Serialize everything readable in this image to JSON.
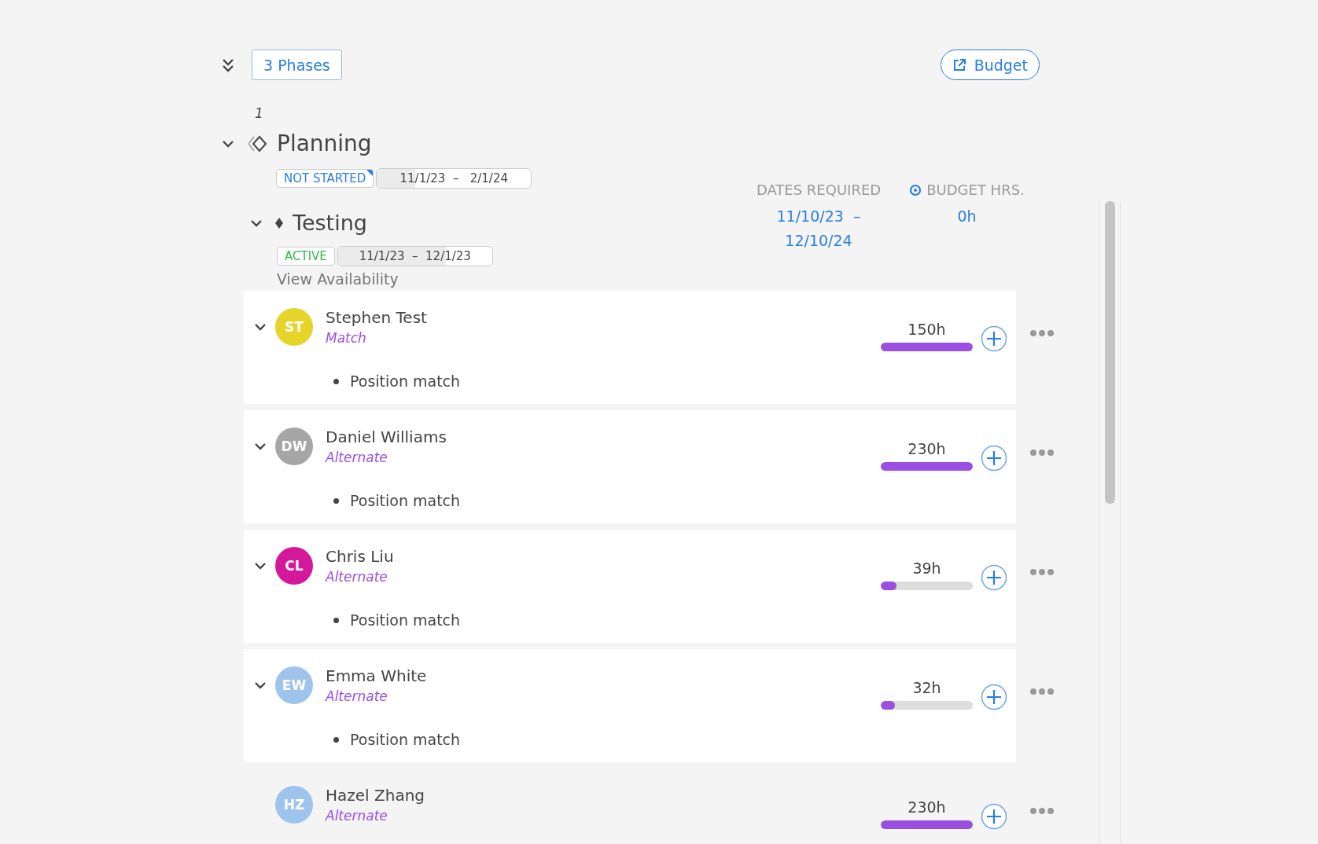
{
  "header": {
    "phases_button": "3 Phases",
    "budget_button": "Budget"
  },
  "phase": {
    "index": "1",
    "title": "Planning",
    "expanded": true,
    "status": {
      "kind": "not_started",
      "label": "NOT STARTED"
    },
    "dates": {
      "start": "11/1/23",
      "separator": "–",
      "end": "2/1/24",
      "level": 0.25
    }
  },
  "requirements": {
    "dates_label": "DATES REQUIRED",
    "dates_start": "11/10/23",
    "dates_separator": "–",
    "dates_end": "12/10/24",
    "budget_label": "BUDGET HRS.",
    "budget_value": "0h"
  },
  "role": {
    "title": "Testing",
    "expanded": true,
    "status": {
      "kind": "active",
      "label": "ACTIVE"
    },
    "dates": {
      "start": "11/1/23",
      "separator": "–",
      "end": "12/1/23",
      "level": 0.7
    },
    "availability_link": "View Availability"
  },
  "members": [
    {
      "initials": "ST",
      "name": "Stephen Test",
      "match": "Match",
      "color": "#e6d42a",
      "expanded": true,
      "details": [
        "Position match"
      ],
      "hours": "150h",
      "level": 1
    },
    {
      "initials": "DW",
      "name": "Daniel Williams",
      "match": "Alternate",
      "color": "#a6a6a6",
      "expanded": true,
      "details": [
        "Position match"
      ],
      "hours": "230h",
      "level": 1
    },
    {
      "initials": "CL",
      "name": "Chris Liu",
      "match": "Alternate",
      "color": "#d4189a",
      "expanded": true,
      "details": [
        "Position match"
      ],
      "hours": "39h",
      "level": 0.17
    },
    {
      "initials": "EW",
      "name": "Emma White",
      "match": "Alternate",
      "color": "#9fc4ec",
      "expanded": true,
      "details": [
        "Position match"
      ],
      "hours": "32h",
      "level": 0.15
    },
    {
      "initials": "HZ",
      "name": "Hazel Zhang",
      "match": "Alternate",
      "color": "#9fc4ec",
      "expanded": false,
      "hours": "230h",
      "level": 1
    }
  ]
}
